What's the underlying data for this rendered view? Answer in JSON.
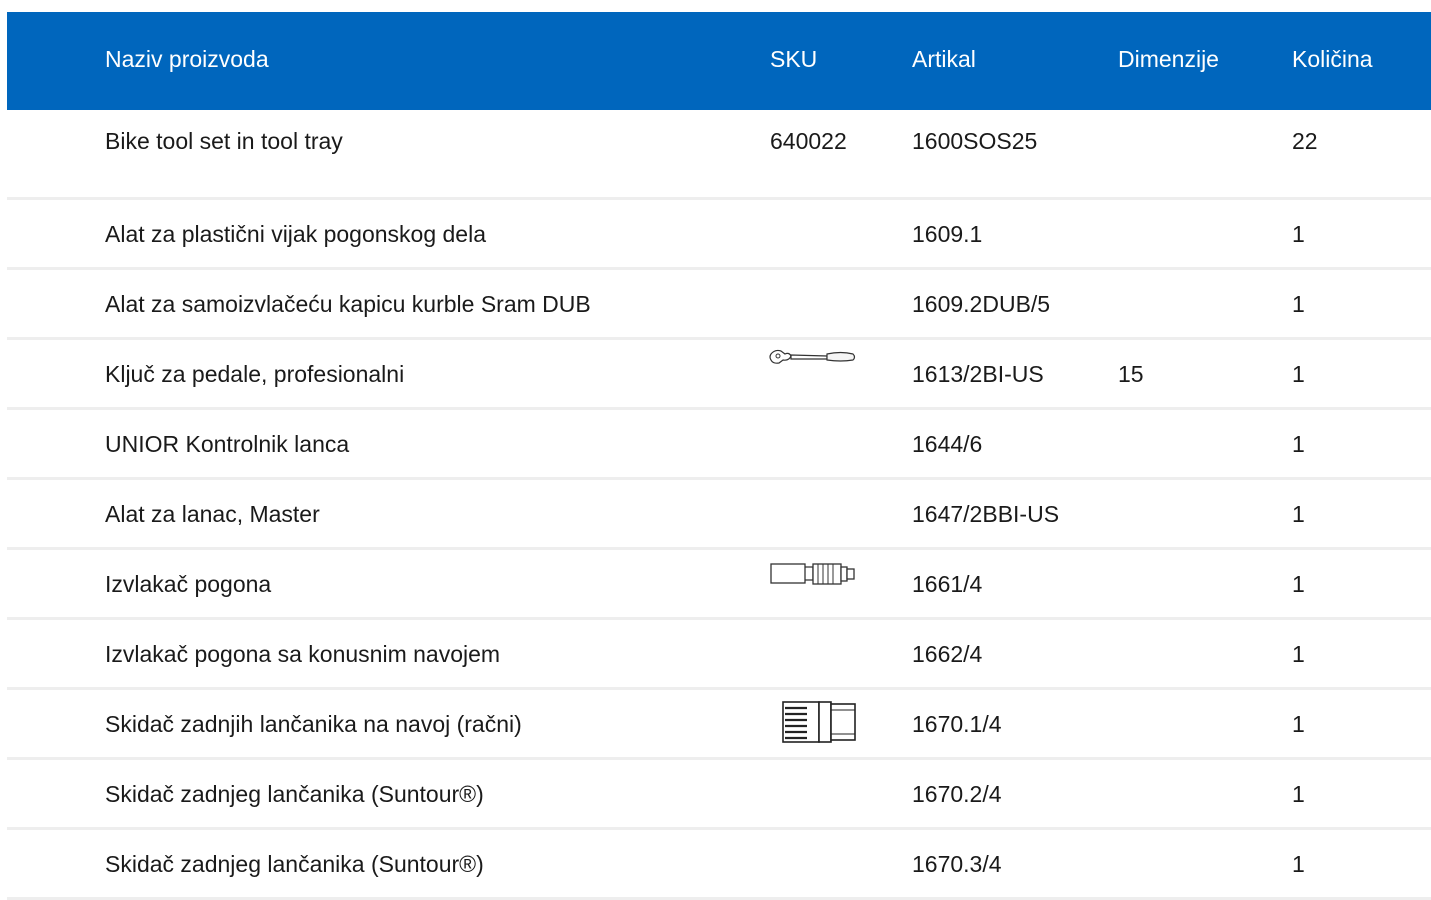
{
  "table": {
    "headers": {
      "name": "Naziv proizvoda",
      "sku": "SKU",
      "article": "Artikal",
      "dimensions": "Dimenzije",
      "quantity": "Količina"
    },
    "header_color": "#0066bd",
    "rows": [
      {
        "name": "Bike tool set in tool tray",
        "sku": "640022",
        "article": "1600SOS25",
        "dimensions": "",
        "quantity": "22"
      },
      {
        "name": "Alat za plastični vijak pogonskog dela",
        "sku": "",
        "article": "1609.1",
        "dimensions": "",
        "quantity": "1"
      },
      {
        "name": "Alat za samoizvlačeću kapicu kurble Sram DUB",
        "sku": "",
        "article": "1609.2DUB/5",
        "dimensions": "",
        "quantity": "1"
      },
      {
        "name": "Ključ za pedale, profesionalni",
        "sku": "",
        "image": "pedal-wrench-thumbnail",
        "article": "1613/2BI-US",
        "dimensions": "15",
        "quantity": "1"
      },
      {
        "name": "UNIOR Kontrolnik lanca",
        "sku": "",
        "article": "1644/6",
        "dimensions": "",
        "quantity": "1"
      },
      {
        "name": "Alat za lanac, Master",
        "sku": "",
        "article": "1647/2BBI-US",
        "dimensions": "",
        "quantity": "1"
      },
      {
        "name": "Izvlakač pogona",
        "sku": "",
        "image": "crank-puller-thumbnail",
        "article": "1661/4",
        "dimensions": "",
        "quantity": "1"
      },
      {
        "name": "Izvlakač pogona sa konusnim navojem",
        "sku": "",
        "article": "1662/4",
        "dimensions": "",
        "quantity": "1"
      },
      {
        "name": "Skidač zadnjih lančanika na navoj (račni)",
        "sku": "",
        "image": "freewheel-remover-thumbnail",
        "article": "1670.1/4",
        "dimensions": "",
        "quantity": "1"
      },
      {
        "name": "Skidač zadnjeg lančanika (Suntour®)",
        "sku": "",
        "article": "1670.2/4",
        "dimensions": "",
        "quantity": "1"
      },
      {
        "name": "Skidač zadnjeg lančanika (Suntour®)",
        "sku": "",
        "article": "1670.3/4",
        "dimensions": "",
        "quantity": "1"
      }
    ]
  }
}
